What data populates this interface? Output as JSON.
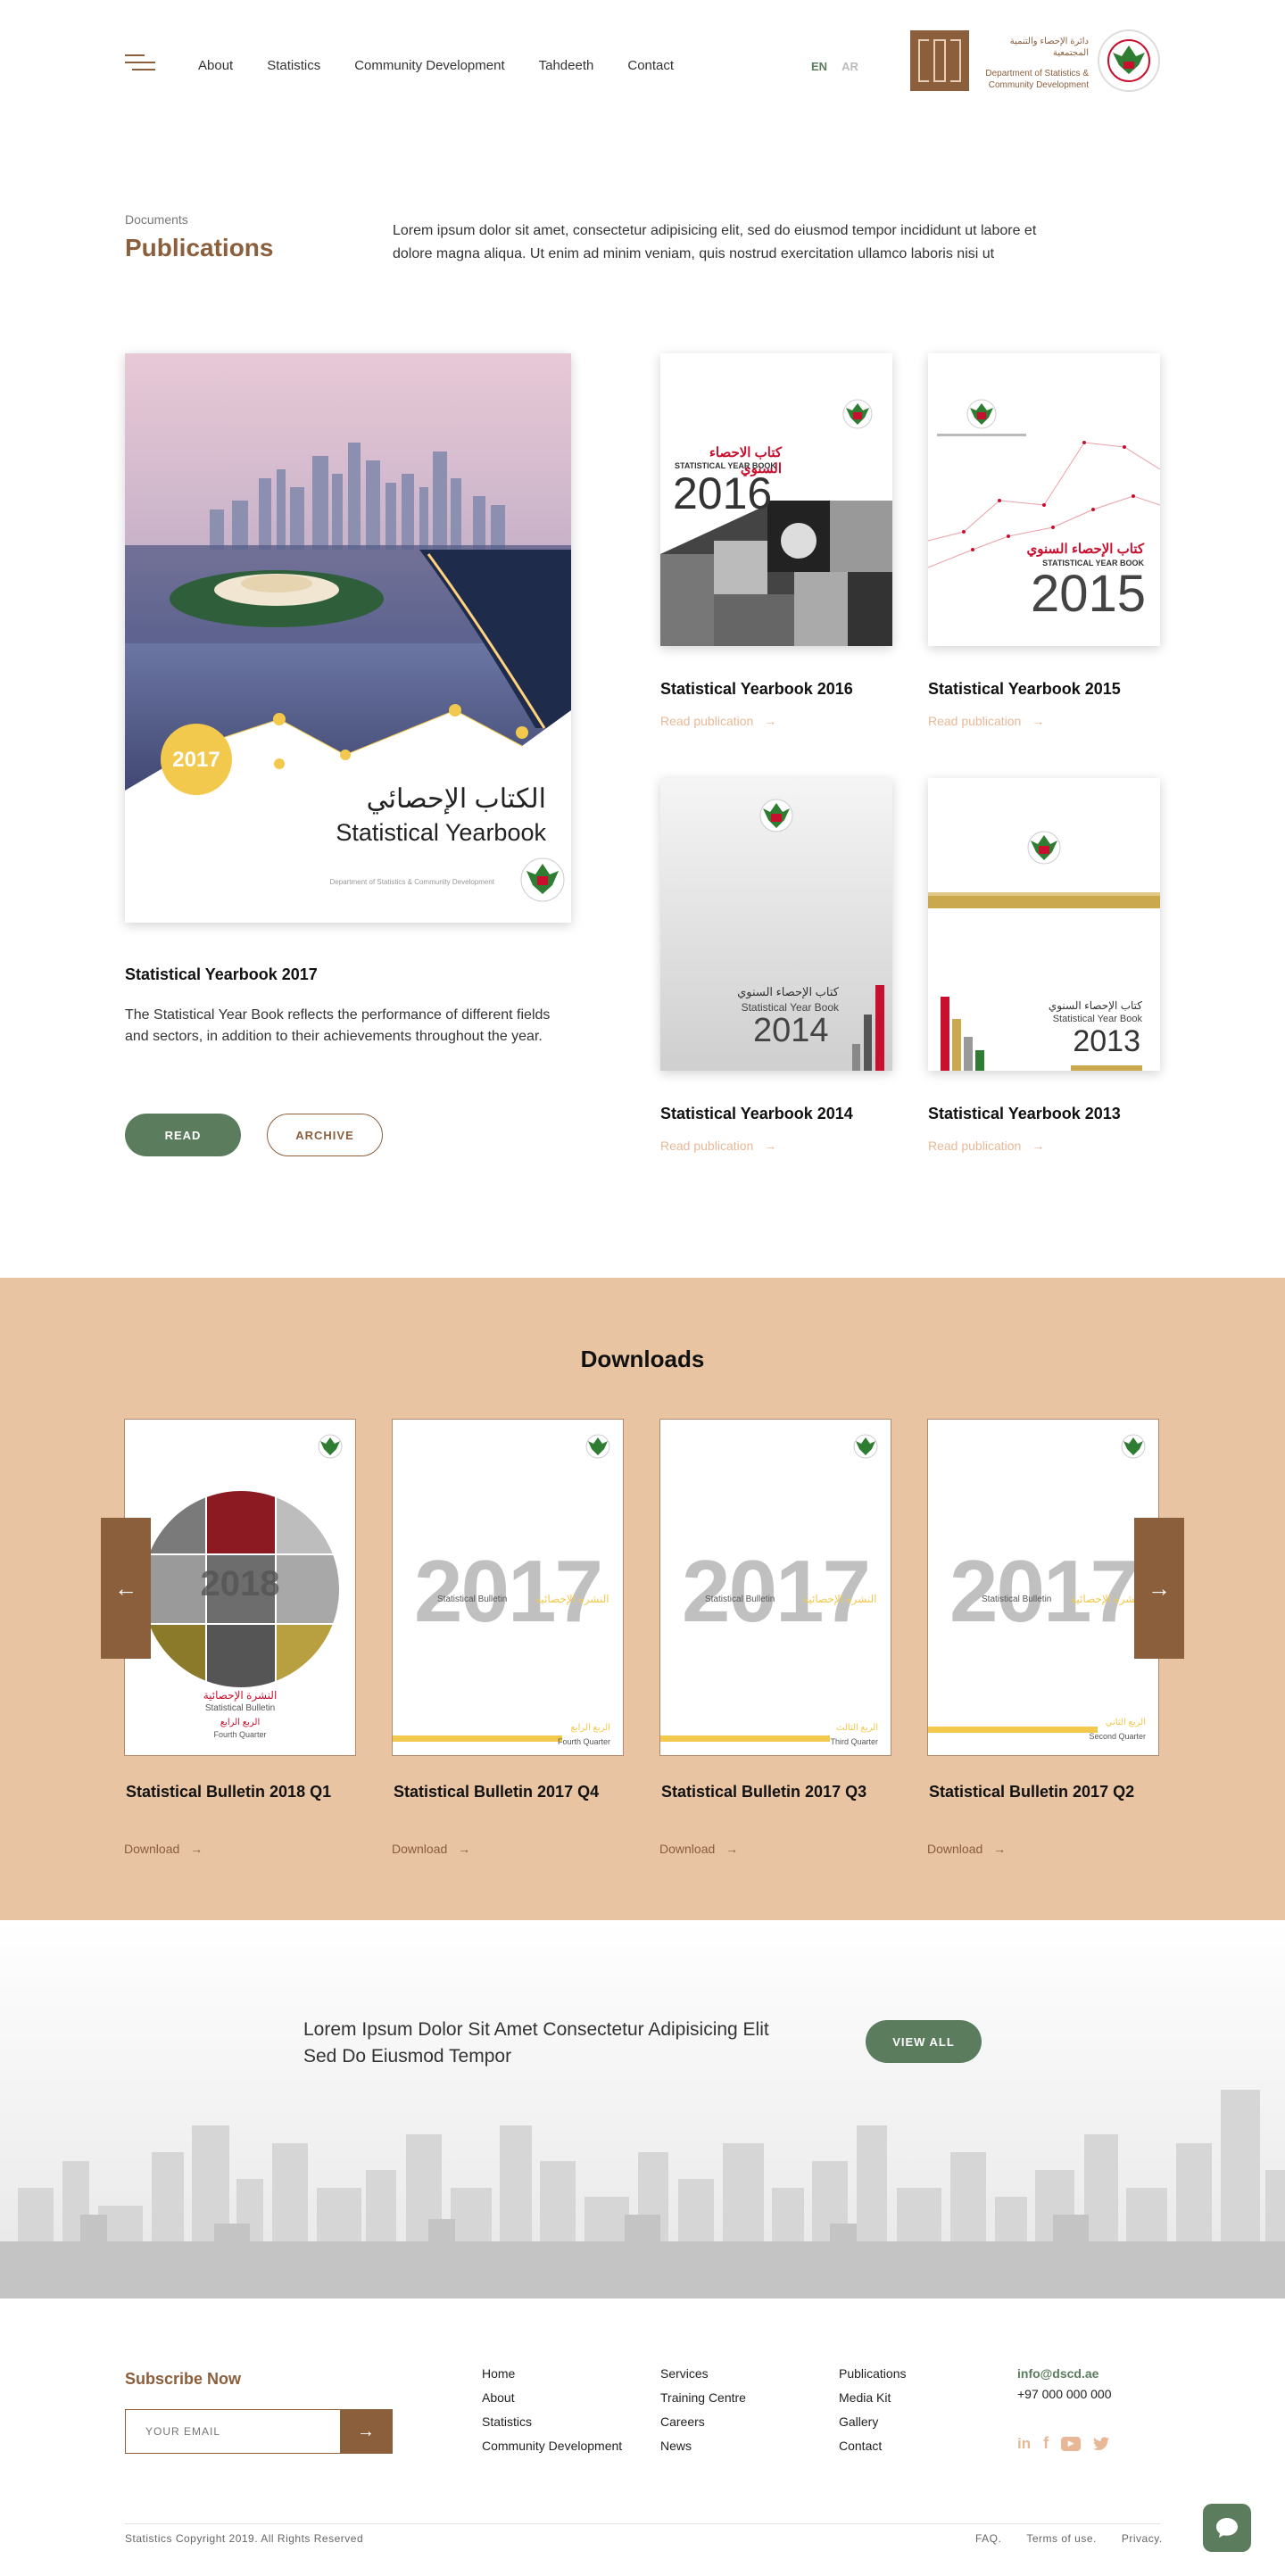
{
  "header": {
    "nav": [
      "About",
      "Statistics",
      "Community Development",
      "Tahdeeth",
      "Contact"
    ],
    "lang_en": "EN",
    "lang_ar": "AR",
    "logo_text_ar": "دائرة الإحصاء والتنمية المجتمعية",
    "logo_text_en_1": "Department of Statistics &",
    "logo_text_en_2": "Community Development"
  },
  "intro": {
    "breadcrumb": "Documents",
    "title": "Publications",
    "text": "Lorem ipsum dolor sit amet, consectetur adipisicing elit, sed do eiusmod tempor incididunt ut labore et dolore magna aliqua. Ut enim ad minim veniam, quis nostrud exercitation ullamco laboris nisi ut"
  },
  "featured": {
    "badge": "2017",
    "cover_ar": "الكتاب الإحصائي",
    "cover_en": "Statistical Yearbook",
    "cover_dept": "Department of Statistics & Community Development",
    "title": "Statistical Yearbook 2017",
    "description": "The Statistical Year Book reflects the performance of different fields and sectors, in addition to their achievements throughout the year.",
    "read_label": "READ",
    "archive_label": "ARCHIVE"
  },
  "publications": [
    {
      "title": "Statistical Yearbook 2016",
      "link": "Read publication",
      "year": "2016",
      "cover_ar": "كتاب الاحصاء السنوي",
      "cover_en": "STATISTICAL YEAR BOOK"
    },
    {
      "title": "Statistical Yearbook 2015",
      "link": "Read publication",
      "year": "2015",
      "cover_ar": "كتاب الإحصاء السنوي",
      "cover_en": "STATISTICAL YEAR BOOK"
    },
    {
      "title": "Statistical Yearbook 2014",
      "link": "Read publication",
      "year": "2014",
      "cover_ar": "كتاب الإحصاء السنوي",
      "cover_en": "Statistical Year Book"
    },
    {
      "title": "Statistical Yearbook 2013",
      "link": "Read publication",
      "year": "2013",
      "cover_ar": "كتاب الإحصاء السنوي",
      "cover_en": "Statistical Year Book"
    }
  ],
  "downloads": {
    "title": "Downloads",
    "items": [
      {
        "title": "Statistical Bulletin 2018 Q1",
        "link": "Download",
        "year": "2018",
        "cover_ar": "النشرة الإحصائية",
        "cover_en": "Statistical Bulletin",
        "quarter_ar": "الربع الرابع",
        "quarter": "Fourth Quarter"
      },
      {
        "title": "Statistical Bulletin 2017 Q4",
        "link": "Download",
        "year": "2017",
        "cover_ar": "النشرة الإحصائية",
        "cover_en": "Statistical Bulletin",
        "quarter_ar": "الربع الرابع",
        "quarter": "Fourth Quarter"
      },
      {
        "title": "Statistical Bulletin 2017 Q3",
        "link": "Download",
        "year": "2017",
        "cover_ar": "النشرة الإحصائية",
        "cover_en": "Statistical Bulletin",
        "quarter_ar": "الربع الثالث",
        "quarter": "Third Quarter"
      },
      {
        "title": "Statistical Bulletin 2017 Q2",
        "link": "Download",
        "year": "2017",
        "cover_ar": "النشرة الإحصائية",
        "cover_en": "Statistical Bulletin",
        "quarter_ar": "الربع الثاني",
        "quarter": "Second Quarter"
      }
    ]
  },
  "cta": {
    "text": "Lorem Ipsum Dolor Sit Amet Consectetur Adipisicing Elit Sed Do Eiusmod Tempor",
    "button": "VIEW ALL"
  },
  "footer": {
    "subscribe_title": "Subscribe Now",
    "email_placeholder": "YOUR EMAIL",
    "col1": [
      "Home",
      "About",
      "Statistics",
      "Community Development"
    ],
    "col2": [
      "Services",
      "Training Centre",
      "Careers",
      "News"
    ],
    "col3": [
      "Publications",
      "Media Kit",
      "Gallery",
      "Contact"
    ],
    "email": "info@dscd.ae",
    "phone": "+97 000 000 000",
    "copyright": "Statistics Copyright 2019. All Rights Reserved",
    "legal": [
      "FAQ.",
      "Terms of use.",
      "Privacy."
    ]
  },
  "colors": {
    "brand_brown": "#8b5e3c",
    "accent_green": "#5b7d5e",
    "downloads_bg": "#e8c4a2",
    "link_peach": "#e8b896"
  }
}
